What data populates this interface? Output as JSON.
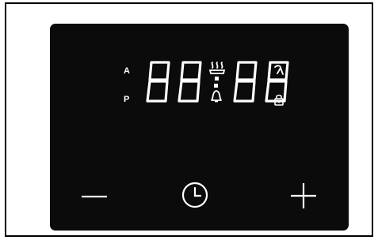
{
  "display": {
    "am_label": "A",
    "pm_label": "P",
    "digits": [
      "8",
      "8",
      "8",
      "8"
    ],
    "colon": ":",
    "indicator_icons": [
      "steam-icon",
      "bell-icon",
      "cleaning-icon",
      "lock-icon"
    ]
  },
  "controls": [
    {
      "name": "minus-button",
      "icon": "minus-icon"
    },
    {
      "name": "clock-button",
      "icon": "clock-icon"
    },
    {
      "name": "plus-button",
      "icon": "plus-icon"
    }
  ],
  "colors": {
    "panel": "#0b0b0b",
    "segment": "#ffffff",
    "frame": "#000000",
    "background": "#ffffff"
  }
}
